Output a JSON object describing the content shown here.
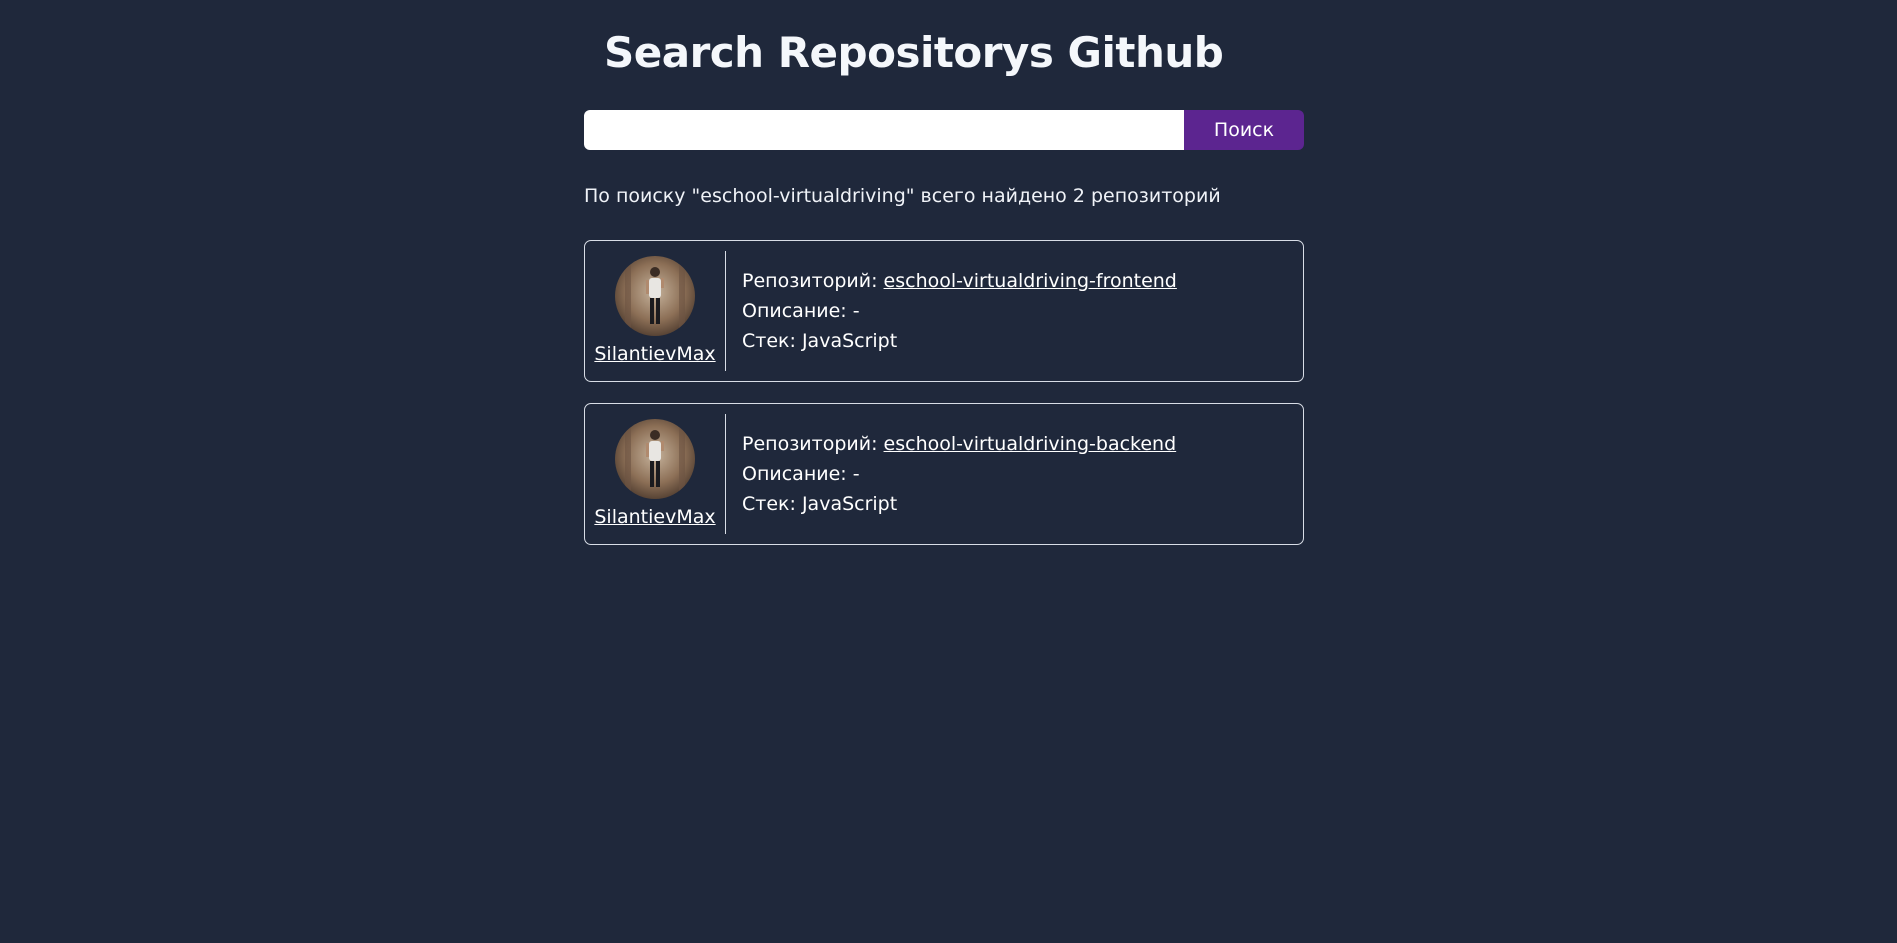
{
  "page": {
    "title": "Search Repositorys Github"
  },
  "search": {
    "value": "",
    "placeholder": "",
    "button_label": "Поиск"
  },
  "results": {
    "summary": "По поиску \"eschool-virtualdriving\" всего найдено 2 репозиторий",
    "labels": {
      "repo": "Репозиторий: ",
      "description": "Описание: ",
      "stack": "Стек: "
    },
    "items": [
      {
        "owner": "SilantievMax",
        "repo": "eschool-virtualdriving-frontend",
        "description": "-",
        "stack": "JavaScript"
      },
      {
        "owner": "SilantievMax",
        "repo": "eschool-virtualdriving-backend",
        "description": "-",
        "stack": "JavaScript"
      }
    ]
  },
  "colors": {
    "background": "#1f283b",
    "accent": "#5c2590",
    "text": "#ffffff",
    "border": "#d8dde6"
  }
}
